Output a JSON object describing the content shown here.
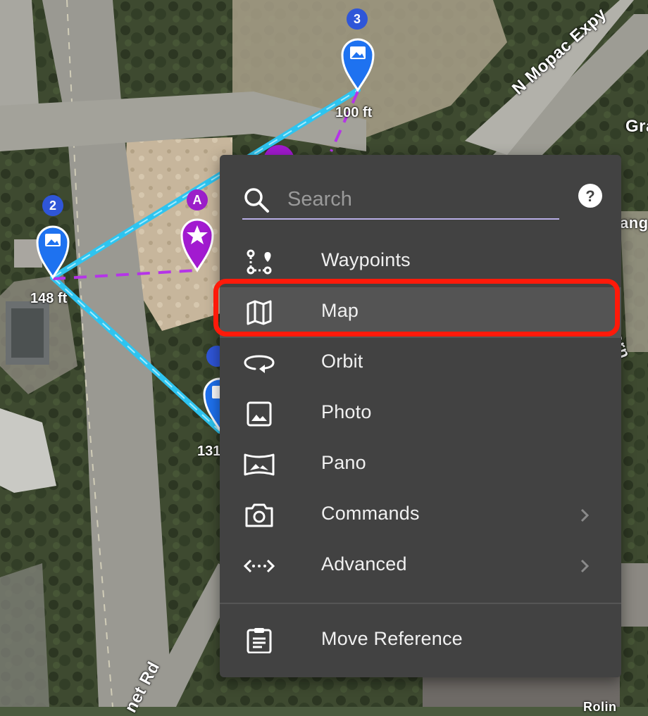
{
  "map": {
    "distance_labels": [
      "100 ft",
      "148 ft",
      "131"
    ],
    "road_labels": [
      "N Mopac Expy",
      "net Rd"
    ],
    "partial_labels": [
      "Gra",
      "ang",
      "arn",
      "Rolin"
    ],
    "waypoint_badges": [
      "3",
      "2",
      "A"
    ],
    "colors": {
      "route_cyan": "#2ec4f0",
      "waypoint_blue": "#1e72f0",
      "poi_purple": "#a21ad0",
      "dashed_purple": "#b534e8"
    },
    "icons": [
      "image-pin-icon",
      "star-pin-icon"
    ]
  },
  "menu": {
    "search": {
      "placeholder": "Search",
      "value": ""
    },
    "help_icon": "help-circle-icon",
    "items": [
      {
        "label": "Waypoints",
        "icon": "waypoints-icon",
        "has_submenu": false,
        "selected": false
      },
      {
        "label": "Map",
        "icon": "map-icon",
        "has_submenu": false,
        "selected": true
      },
      {
        "label": "Orbit",
        "icon": "orbit-icon",
        "has_submenu": false,
        "selected": false
      },
      {
        "label": "Photo",
        "icon": "photo-icon",
        "has_submenu": false,
        "selected": false
      },
      {
        "label": "Pano",
        "icon": "pano-icon",
        "has_submenu": false,
        "selected": false
      },
      {
        "label": "Commands",
        "icon": "camera-icon",
        "has_submenu": true,
        "selected": false
      },
      {
        "label": "Advanced",
        "icon": "advanced-icon",
        "has_submenu": true,
        "selected": false
      }
    ],
    "footer_items": [
      {
        "label": "Move Reference",
        "icon": "clipboard-icon"
      }
    ],
    "colors": {
      "background": "#424242",
      "selected_background": "#545454",
      "highlight_outline": "#ff1a0a",
      "search_underline": "#b8aee6"
    }
  }
}
